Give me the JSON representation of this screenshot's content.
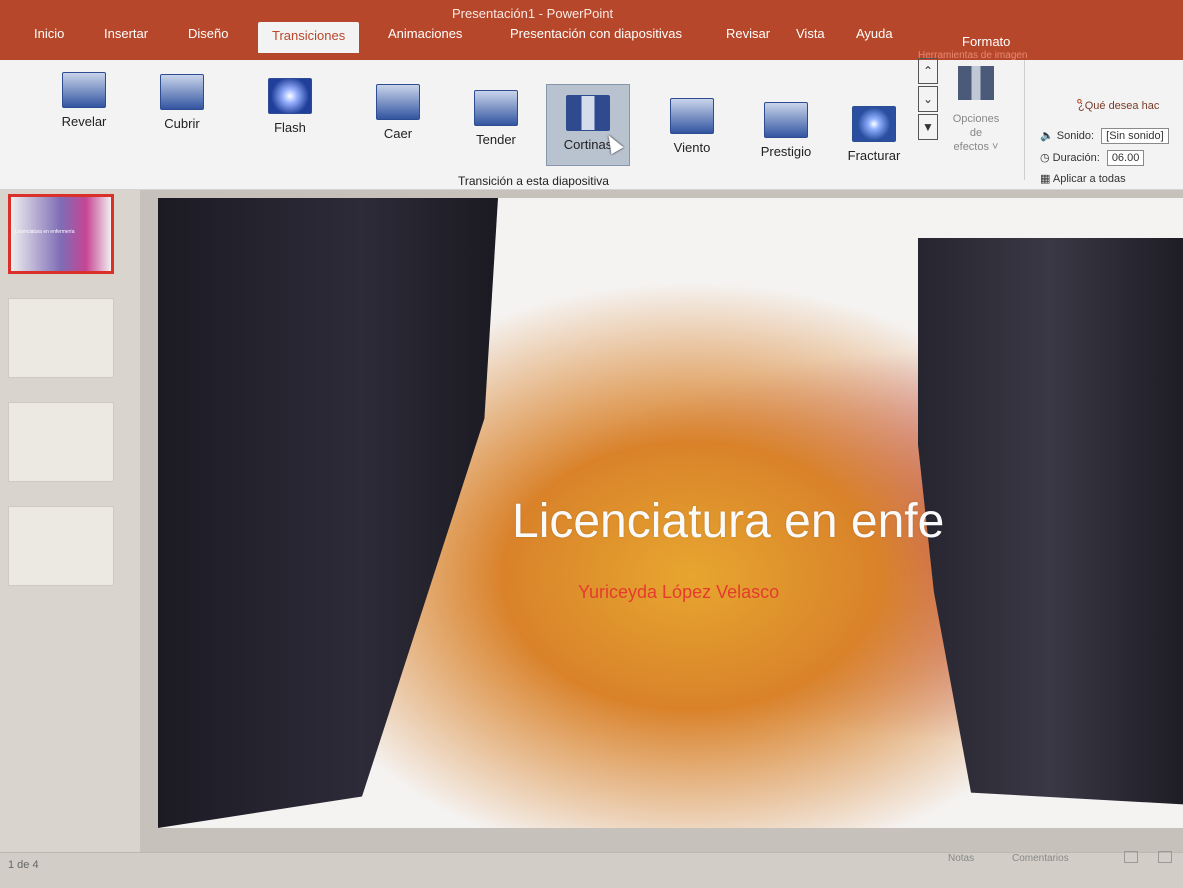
{
  "window": {
    "title": "Presentación1 - PowerPoint"
  },
  "tabs": [
    {
      "label": "Inicio"
    },
    {
      "label": "Insertar"
    },
    {
      "label": "Diseño"
    },
    {
      "label": "Transiciones",
      "active": true
    },
    {
      "label": "Animaciones"
    },
    {
      "label": "Presentación con diapositivas"
    },
    {
      "label": "Revisar"
    },
    {
      "label": "Vista"
    },
    {
      "label": "Ayuda"
    },
    {
      "label": "Formato"
    }
  ],
  "contextual_label": "Herramientas de imagen",
  "tell_me": "¿Qué desea hac",
  "transitions": [
    {
      "label": "Revelar",
      "icon": "reveal-icon"
    },
    {
      "label": "Cubrir",
      "icon": "cover-icon"
    },
    {
      "label": "Flash",
      "icon": "flash-icon"
    },
    {
      "label": "Caer",
      "icon": "fall-icon"
    },
    {
      "label": "Tender",
      "icon": "drape-icon"
    },
    {
      "label": "Cortinas",
      "icon": "curtains-icon",
      "selected": true
    },
    {
      "label": "Viento",
      "icon": "wind-icon"
    },
    {
      "label": "Prestigio",
      "icon": "prestige-icon"
    },
    {
      "label": "Fracturar",
      "icon": "fracture-icon"
    }
  ],
  "group_label": "Transición a esta diapositiva",
  "effect_options": {
    "label_line1": "Opciones de",
    "label_line2": "efectos ˅"
  },
  "timing": {
    "sound_label": "Sonido:",
    "sound_value": "[Sin sonido]",
    "duration_label": "Duración:",
    "duration_value": "06.00",
    "apply_all": "Aplicar a todas"
  },
  "slide": {
    "title": "Licenciatura en enfe",
    "subtitle": "Yuriceyda López Velasco",
    "thumb_title": "Licenciatura en enfermería"
  },
  "status": {
    "page": "1 de 4",
    "notes": "Notas",
    "comments": "Comentarios"
  },
  "colors": {
    "accent": "#b7472a",
    "selection": "#d9302a"
  }
}
